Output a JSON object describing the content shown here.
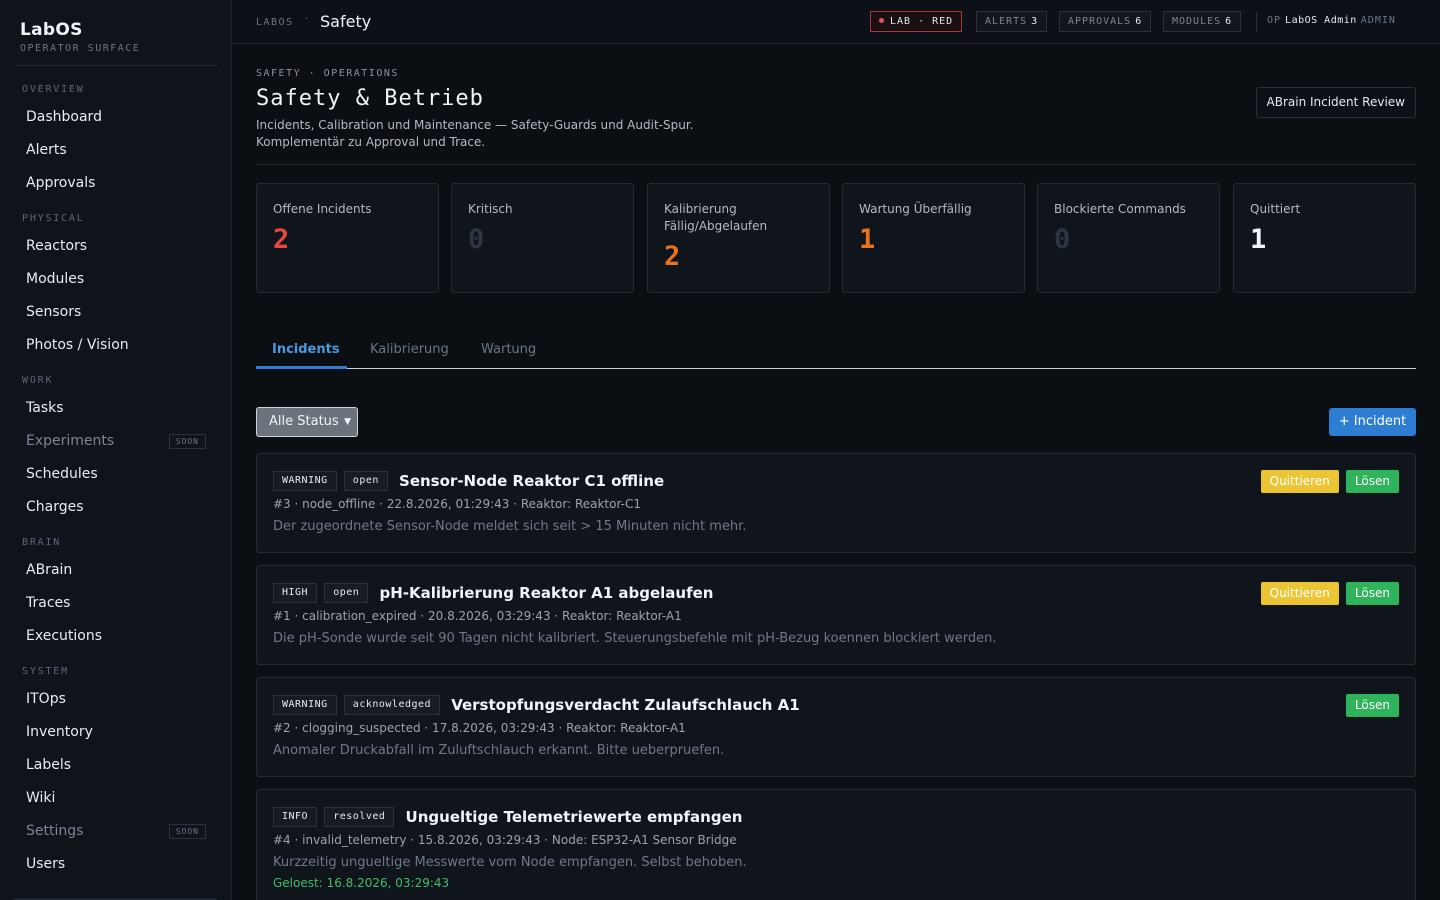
{
  "brand": {
    "title": "LabOS",
    "subtitle": "OPERATOR SURFACE"
  },
  "nav": {
    "overview": {
      "label": "OVERVIEW",
      "items": [
        "Dashboard",
        "Alerts",
        "Approvals"
      ]
    },
    "physical": {
      "label": "PHYSICAL",
      "items": [
        "Reactors",
        "Modules",
        "Sensors",
        "Photos / Vision"
      ]
    },
    "work": {
      "label": "WORK",
      "items": [
        "Tasks",
        "Experiments",
        "Schedules",
        "Charges"
      ]
    },
    "brain": {
      "label": "BRAIN",
      "items": [
        "ABrain",
        "Traces",
        "Executions"
      ]
    },
    "system": {
      "label": "SYSTEM",
      "items": [
        "ITOps",
        "Inventory",
        "Labels",
        "Wiki",
        "Settings",
        "Users"
      ]
    },
    "soon_label": "SOON"
  },
  "topbar": {
    "crumb_root": "LABOS",
    "crumb_sep": "·",
    "page": "Safety",
    "lab_status": "LAB · RED",
    "alerts_label": "ALERTS",
    "alerts_count": "3",
    "approvals_label": "APPROVALS",
    "approvals_count": "6",
    "modules_label": "MODULES",
    "modules_count": "6",
    "user_prefix": "OP",
    "user_name": "LabOS Admin",
    "user_role": "ADMIN"
  },
  "header": {
    "eyebrow": "SAFETY · OPERATIONS",
    "title": "Safety & Betrieb",
    "desc_line1": "Incidents, Calibration und Maintenance — Safety-Guards und Audit-Spur.",
    "desc_line2": "Komplementär zu Approval und Trace.",
    "review_button": "ABrain Incident Review"
  },
  "stats": [
    {
      "label": "Offene Incidents",
      "value": "2",
      "color": "#e5483f"
    },
    {
      "label": "Kritisch",
      "value": "0",
      "color": "#2e3644"
    },
    {
      "label": "Kalibrierung Fällig/Abgelaufen",
      "value": "2",
      "color": "#e8731f"
    },
    {
      "label": "Wartung Überfällig",
      "value": "1",
      "color": "#e8731f"
    },
    {
      "label": "Blockierte Commands",
      "value": "0",
      "color": "#2e3644"
    },
    {
      "label": "Quittiert",
      "value": "1",
      "color": "#f1f4f8"
    }
  ],
  "tabs": [
    "Incidents",
    "Kalibrierung",
    "Wartung"
  ],
  "filter": {
    "status_value": "Alle Status"
  },
  "add_button": "+ Incident",
  "actions": {
    "acknowledge": "Quittieren",
    "resolve": "Lösen"
  },
  "incidents": [
    {
      "severity": "WARNING",
      "status": "open",
      "title": "Sensor-Node Reaktor C1 offline",
      "meta": "#3 · node_offline · 22.8.2026, 01:29:43 · Reaktor: Reaktor-C1",
      "text": "Der zugeordnete Sensor-Node meldet sich seit > 15 Minuten nicht mehr."
    },
    {
      "severity": "HIGH",
      "status": "open",
      "title": "pH-Kalibrierung Reaktor A1 abgelaufen",
      "meta": "#1 · calibration_expired · 20.8.2026, 03:29:43 · Reaktor: Reaktor-A1",
      "text": "Die pH-Sonde wurde seit 90 Tagen nicht kalibriert. Steuerungsbefehle mit pH-Bezug koennen blockiert werden."
    },
    {
      "severity": "WARNING",
      "status": "acknowledged",
      "title": "Verstopfungsverdacht Zulaufschlauch A1",
      "meta": "#2 · clogging_suspected · 17.8.2026, 03:29:43 · Reaktor: Reaktor-A1",
      "text": "Anomaler Druckabfall im Zuluftschlauch erkannt. Bitte ueberpruefen."
    },
    {
      "severity": "INFO",
      "status": "resolved",
      "title": "Ungueltige Telemetriewerte empfangen",
      "meta": "#4 · invalid_telemetry · 15.8.2026, 03:29:43 · Node: ESP32-A1 Sensor Bridge",
      "text": "Kurzzeitig ungueltige Messwerte vom Node empfangen. Selbst behoben.",
      "resolved": "Geloest: 16.8.2026, 03:29:43"
    }
  ]
}
